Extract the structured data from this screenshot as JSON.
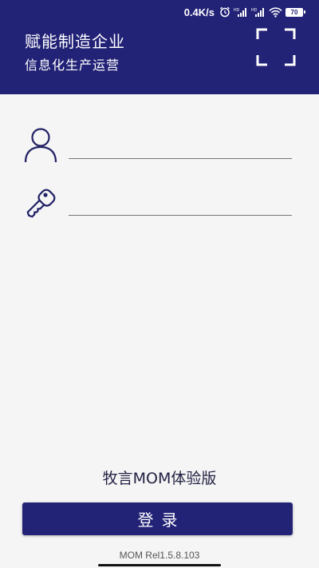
{
  "status_bar": {
    "network_speed": "0.4K/s",
    "alarm_icon": "alarm-icon",
    "signal1_icon": "signal-hd-icon",
    "signal2_icon": "signal-hd-icon",
    "wifi_icon": "wifi-icon",
    "battery_level": "70"
  },
  "header": {
    "title": "赋能制造企业",
    "subtitle": "信息化生产运营",
    "scan_icon": "scan-icon",
    "background_color": "#222277"
  },
  "form": {
    "username": {
      "icon": "user-icon",
      "value": "",
      "placeholder": ""
    },
    "password": {
      "icon": "key-icon",
      "value": "",
      "placeholder": ""
    }
  },
  "app_name": "牧言MOM体验版",
  "login_button": {
    "label": "登录",
    "color": "#222277"
  },
  "version": "MOM Rel1.5.8.103"
}
